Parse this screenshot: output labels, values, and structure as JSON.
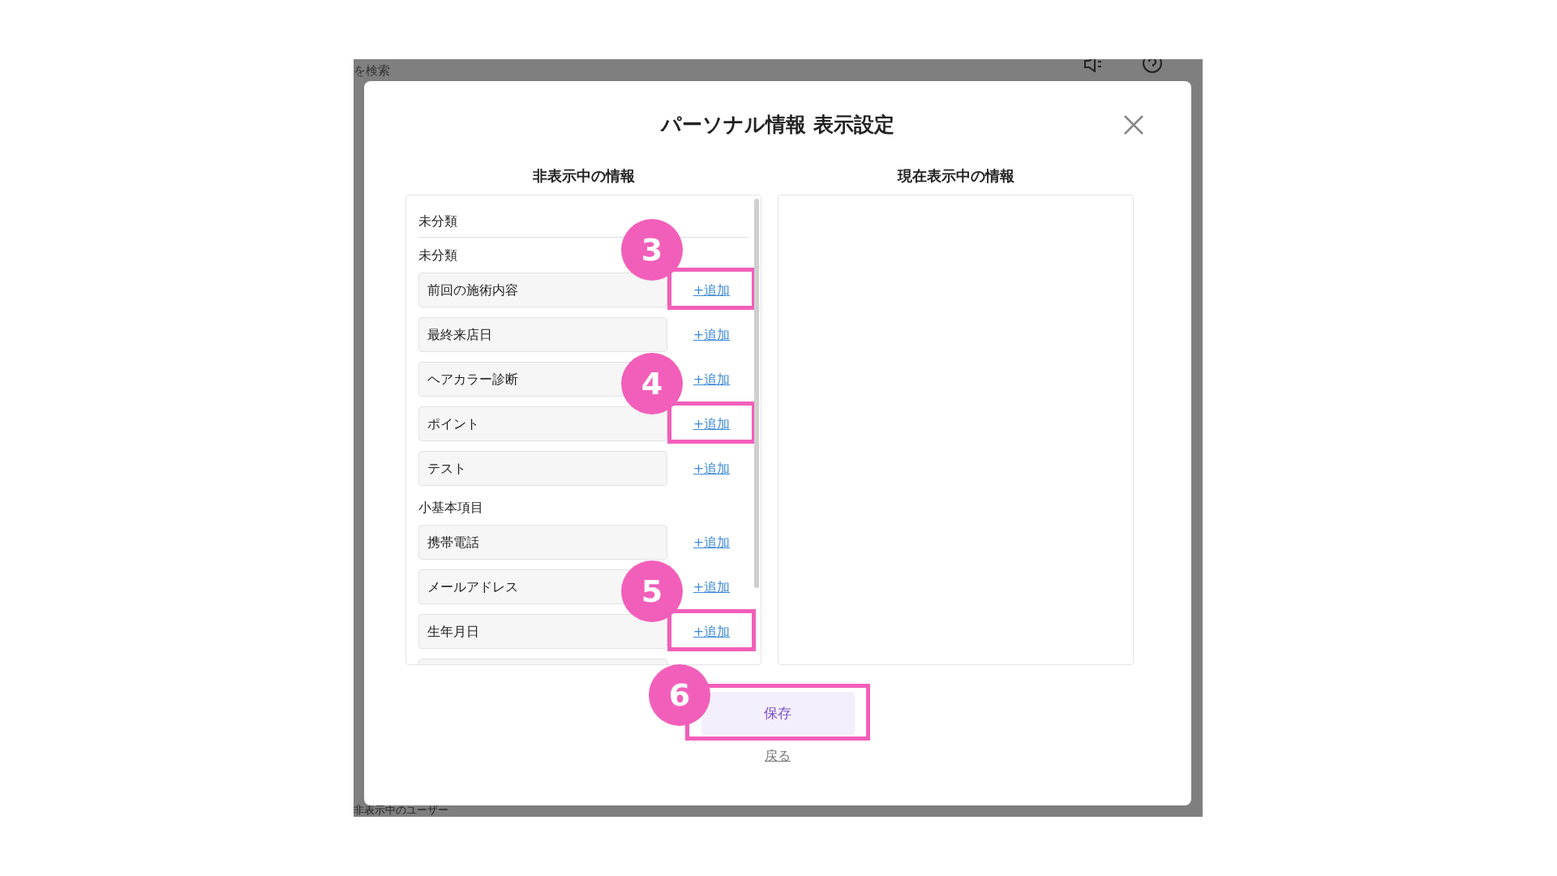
{
  "backdrop": {
    "search_text": "を検索",
    "bottom_text": "非表示中のユーザー"
  },
  "dialog": {
    "title": "パーソナル情報 表示設定",
    "hidden_column": {
      "heading": "非表示中の情報",
      "category": "未分類",
      "groups": [
        {
          "label": "未分類",
          "items": [
            {
              "label": "前回の施術内容",
              "action": "+追加",
              "marker": "3"
            },
            {
              "label": "最終来店日",
              "action": "+追加"
            },
            {
              "label": "ヘアカラー診断",
              "action": "+追加"
            },
            {
              "label": "ポイント",
              "action": "+追加",
              "marker": "4"
            },
            {
              "label": "テスト",
              "action": "+追加"
            }
          ]
        },
        {
          "label": "小基本項目",
          "items": [
            {
              "label": "携帯電話",
              "action": "+追加"
            },
            {
              "label": "メールアドレス",
              "action": "+追加"
            },
            {
              "label": "生年月日",
              "action": "+追加",
              "marker": "5"
            }
          ]
        }
      ]
    },
    "shown_column": {
      "heading": "現在表示中の情報"
    },
    "save_button": {
      "label": "保存",
      "marker": "6"
    },
    "back_link": "戻る"
  }
}
